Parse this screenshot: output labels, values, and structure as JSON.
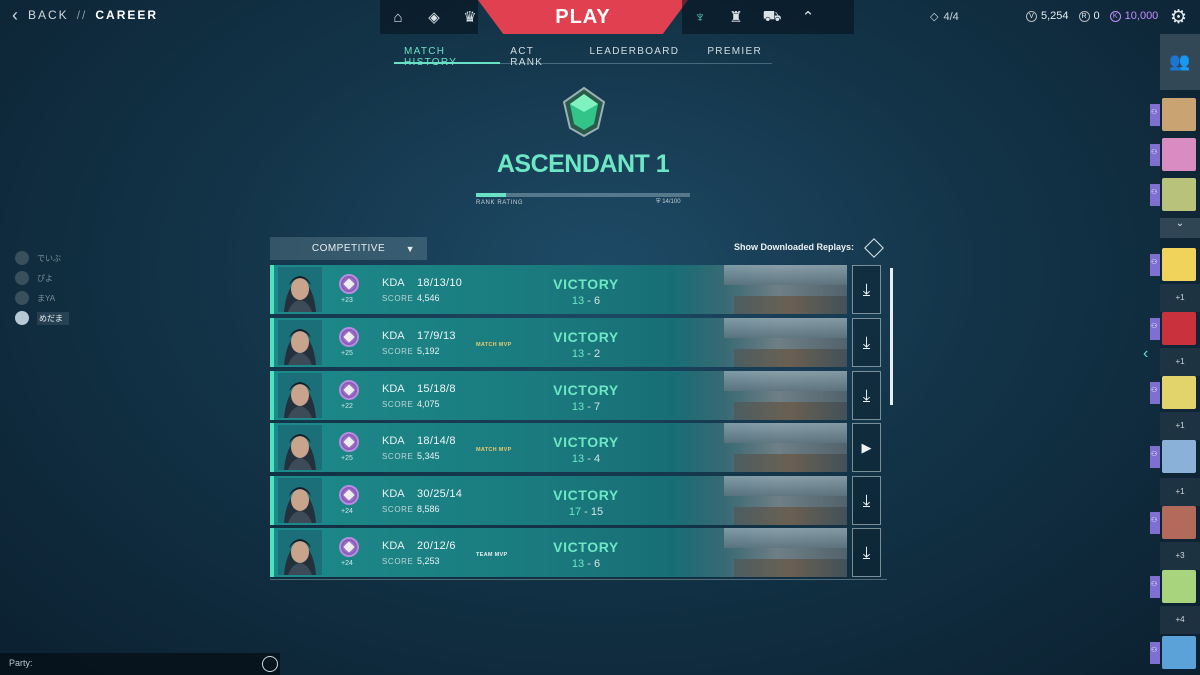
{
  "topbar": {
    "back_label": "BACK",
    "separator": "//",
    "current_page": "CAREER",
    "play_label": "PLAY",
    "party_count": "4/4",
    "currencies": [
      {
        "icon": "valorant-points-icon",
        "value": "5,254"
      },
      {
        "icon": "radianite-icon",
        "value": "0"
      },
      {
        "icon": "kingdom-credits-icon",
        "value": "10,000"
      }
    ],
    "left_icons": [
      "home-icon",
      "agents-icon",
      "collection-icon"
    ],
    "right_icons": [
      "career-icon",
      "battlepass-icon",
      "store-icon",
      "rank-icon"
    ]
  },
  "tabs": [
    {
      "label": "MATCH HISTORY",
      "active": true
    },
    {
      "label": "ACT RANK",
      "active": false
    },
    {
      "label": "LEADERBOARD",
      "active": false
    },
    {
      "label": "PREMIER",
      "active": false
    }
  ],
  "rank": {
    "name": "ASCENDANT 1",
    "rr_label": "RANK RATING",
    "rr_value": "14/100",
    "rr_fraction": 0.14,
    "accent": "#6ae1c5"
  },
  "filters": {
    "mode": "COMPETITIVE",
    "replays_label": "Show Downloaded Replays:"
  },
  "matches": [
    {
      "kda_label": "KDA",
      "kda": "18/13/10",
      "score_label": "SCORE",
      "score": "4,546",
      "rr": "+23",
      "mvp": "",
      "result": "VICTORY",
      "team_score": "13",
      "enemy_score": "6",
      "action": "download"
    },
    {
      "kda_label": "KDA",
      "kda": "17/9/13",
      "score_label": "SCORE",
      "score": "5,192",
      "rr": "+25",
      "mvp": "MATCH MVP",
      "result": "VICTORY",
      "team_score": "13",
      "enemy_score": "2",
      "action": "download"
    },
    {
      "kda_label": "KDA",
      "kda": "15/18/8",
      "score_label": "SCORE",
      "score": "4,075",
      "rr": "+22",
      "mvp": "",
      "result": "VICTORY",
      "team_score": "13",
      "enemy_score": "7",
      "action": "download"
    },
    {
      "kda_label": "KDA",
      "kda": "18/14/8",
      "score_label": "SCORE",
      "score": "5,345",
      "rr": "+25",
      "mvp": "MATCH MVP",
      "result": "VICTORY",
      "team_score": "13",
      "enemy_score": "4",
      "action": "play"
    },
    {
      "kda_label": "KDA",
      "kda": "30/25/14",
      "score_label": "SCORE",
      "score": "8,586",
      "rr": "+24",
      "mvp": "",
      "result": "VICTORY",
      "team_score": "17",
      "enemy_score": "15",
      "action": "download"
    },
    {
      "kda_label": "KDA",
      "kda": "20/12/6",
      "score_label": "SCORE",
      "score": "5,253",
      "rr": "+24",
      "mvp": "TEAM MVP",
      "result": "VICTORY",
      "team_score": "13",
      "enemy_score": "6",
      "action": "download"
    }
  ],
  "friends": [
    {
      "name": "でいぶ",
      "active": false
    },
    {
      "name": "ぴよ",
      "active": false
    },
    {
      "name": "まYA",
      "active": false
    },
    {
      "name": "めだま",
      "active": true
    }
  ],
  "party_chat": {
    "label": "Party:"
  },
  "rail": {
    "plus_counts": [
      "+1",
      "+1",
      "+1",
      "+1",
      "+3",
      "+4"
    ]
  }
}
